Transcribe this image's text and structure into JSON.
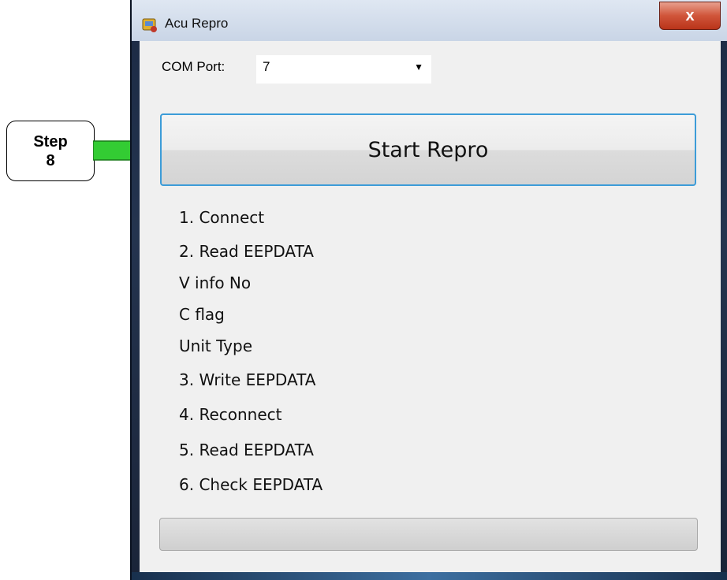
{
  "callout": {
    "line1": "Step",
    "line2": "8",
    "arrow_color": "#33cc33"
  },
  "window": {
    "title": "Acu Repro",
    "close_glyph": "x",
    "app_icon": "acu-repro-app-icon"
  },
  "com_port": {
    "label": "COM Port:",
    "value": "7"
  },
  "start_button": {
    "label": "Start Repro",
    "accent": "#3c9cd8"
  },
  "steps": [
    "1. Connect",
    "2. Read EEPDATA",
    "V info No",
    "C flag",
    "Unit Type",
    "3. Write EEPDATA",
    "4. Reconnect",
    "5. Read EEPDATA",
    "6. Check EEPDATA"
  ],
  "progress": {
    "value": 0
  }
}
